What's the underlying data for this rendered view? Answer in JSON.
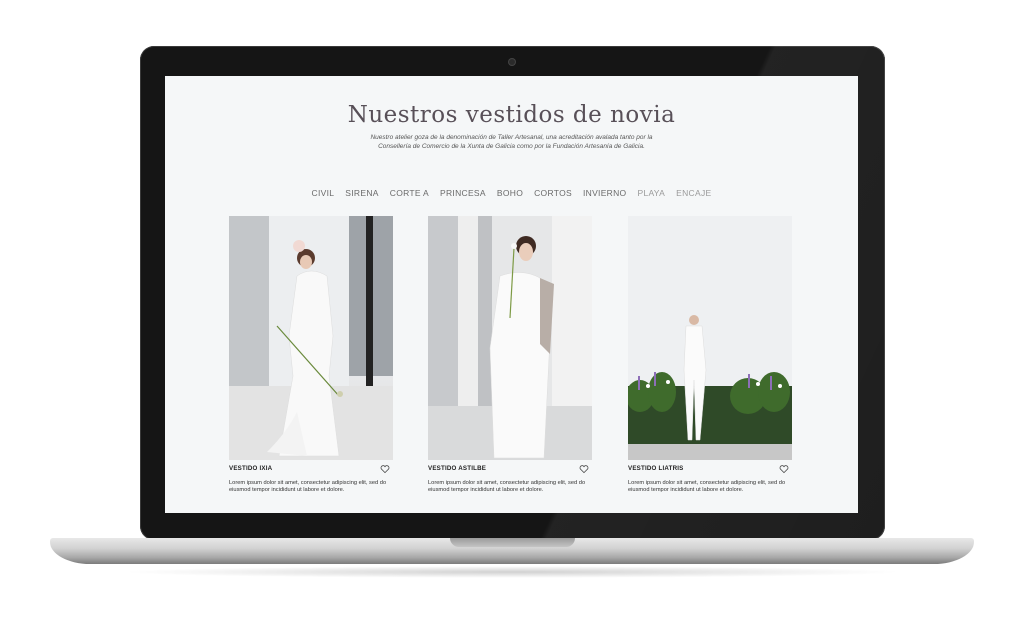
{
  "page": {
    "title": "Nuestros vestidos de novia",
    "subtitle": "Nuestro atelier goza de la denominación de Taller Artesanal, una acreditación avalada tanto por la Consellería de Comercio de la Xunta de Galicia como por la Fundación Artesanía de Galicia."
  },
  "nav": {
    "items": [
      "CIVIL",
      "SIRENA",
      "CORTE A",
      "PRINCESA",
      "BOHO",
      "CORTOS",
      "INVIERNO",
      "PLAYA",
      "ENCAJE"
    ]
  },
  "products": [
    {
      "name": "VESTIDO IXIA",
      "description": "Lorem ipsum dolor sit amet, consectetur adipiscing elit, sed do eiusmod tempor incididunt ut labore et dolore."
    },
    {
      "name": "VESTIDO ASTILBE",
      "description": "Lorem ipsum dolor sit amet, consectetur adipiscing elit, sed do eiusmod tempor incididunt ut labore et dolore."
    },
    {
      "name": "VESTIDO LIATRIS",
      "description": "Lorem ipsum dolor sit amet, consectetur adipiscing elit, sed do eiusmod tempor incididunt ut labore et dolore."
    }
  ],
  "icons": {
    "favorite": "heart-outline-icon"
  },
  "colors": {
    "title": "#585058",
    "nav_text": "#6a6a6a",
    "screen_bg": "#f5f7f8",
    "laptop_bezel": "#151515"
  }
}
